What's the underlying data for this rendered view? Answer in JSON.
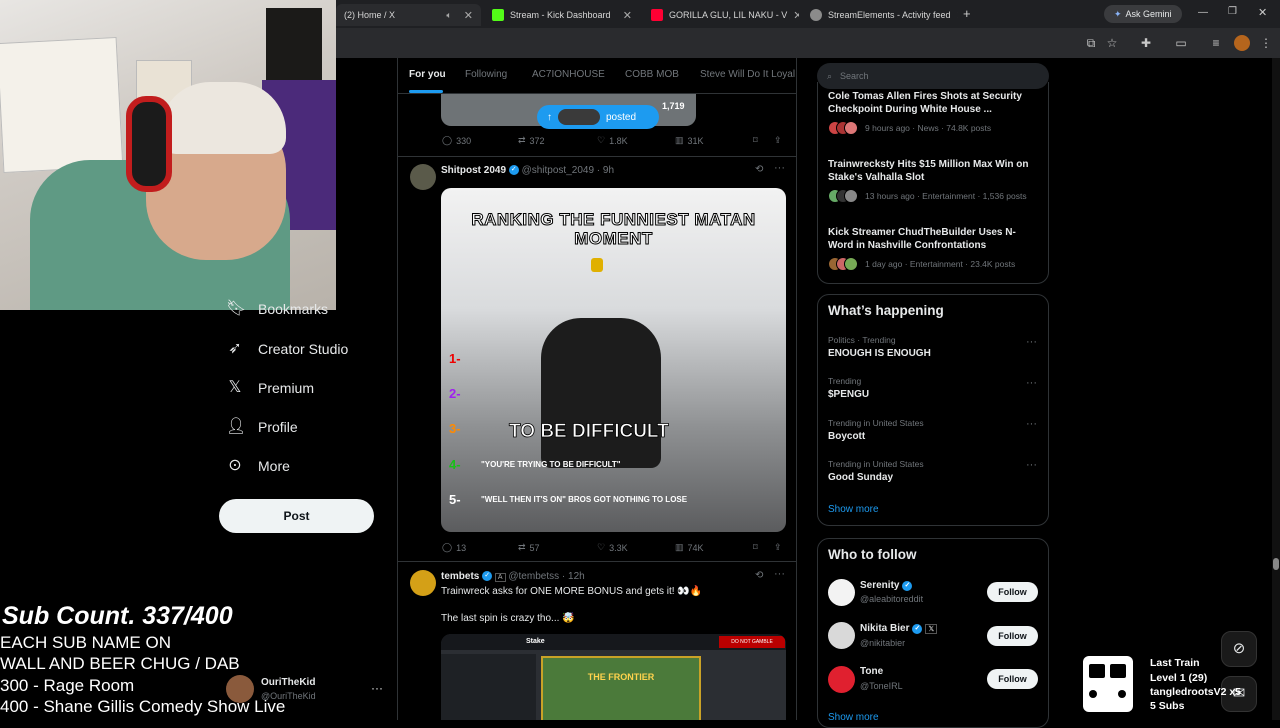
{
  "browser": {
    "tabs": [
      {
        "label": "(2) Home / X",
        "favicon_color": "#000000"
      },
      {
        "label": "Stream - Kick Dashboard",
        "favicon_color": "#53fc18"
      },
      {
        "label": "GORILLA GLU, LIL NAKU - V",
        "favicon_color": "#ff0033"
      },
      {
        "label": "StreamElements - Activity feed",
        "favicon_color": "#8b8b8b"
      }
    ],
    "new_tab": "+",
    "gemini_label": "Ask Gemini"
  },
  "overlay": {
    "sub_count": "Sub Count. 337/400",
    "lines": [
      "EACH SUB NAME ON",
      "WALL AND BEER CHUG / DAB",
      "300 - Rage Room",
      "400 - Shane Gillis Comedy Show Live"
    ]
  },
  "sidebar": {
    "items": [
      {
        "label": "Bookmarks",
        "icon": "bookmark-icon"
      },
      {
        "label": "Creator Studio",
        "icon": "rocket-icon"
      },
      {
        "label": "Premium",
        "icon": "x-logo-icon"
      },
      {
        "label": "Profile",
        "icon": "person-icon"
      },
      {
        "label": "More",
        "icon": "more-circle-icon"
      }
    ],
    "post_button": "Post",
    "account": {
      "name": "OuriTheKid",
      "handle": "@OuriTheKid"
    }
  },
  "feed": {
    "tabs": [
      "For you",
      "Following",
      "AC7IONHOUSE",
      "COBB MOB",
      "Steve Will Do It Loyal"
    ],
    "posted_pill": "posted",
    "top_post": {
      "image_count": "1,719",
      "actions": {
        "replies": "330",
        "reposts": "372",
        "likes": "1.8K",
        "views": "31K"
      }
    },
    "post1": {
      "name": "Shitpost 2049",
      "handle": "@shitpost_2049",
      "time": "9h",
      "media_title": "RANKING THE FUNNIEST MATAN MOMENT",
      "media_caption": "TO BE DIFFICULT",
      "media_line4": "\"YOU'RE TRYING TO BE DIFFICULT\"",
      "media_line5": "\"WELL THEN IT'S ON\" BROS GOT NOTHING TO LOSE",
      "rank_labels": [
        "1-",
        "2-",
        "3-",
        "4-",
        "5-"
      ],
      "actions": {
        "replies": "13",
        "reposts": "57",
        "likes": "3.3K",
        "views": "74K"
      }
    },
    "post2": {
      "name": "tembets",
      "badge": "A",
      "handle": "@tembetss",
      "time": "12h",
      "text": "Trainwreck asks for ONE MORE BONUS and gets it! 👀🔥",
      "text2": "The last spin is crazy tho... 🤯",
      "media_label": "THE FRONTIER",
      "media_tag": "DO NOT GAMBLE",
      "media_logo": "Stake"
    }
  },
  "right": {
    "search_placeholder": "Search",
    "news": [
      {
        "title": "Cole Tomas Allen Fires Shots at Security Checkpoint During White House ...",
        "meta": "9 hours ago · News · 74.8K posts"
      },
      {
        "title": "Trainwrecksty Hits $15 Million Max Win on Stake's Valhalla Slot",
        "meta": "13 hours ago · Entertainment · 1,536 posts"
      },
      {
        "title": "Kick Streamer ChudTheBuilder Uses N-Word in Nashville Confrontations",
        "meta": "1 day ago · Entertainment · 23.4K posts"
      }
    ],
    "happening_title": "What’s happening",
    "trends": [
      {
        "category": "Politics · Trending",
        "name": "ENOUGH IS ENOUGH"
      },
      {
        "category": "Trending",
        "name": "$PENGU"
      },
      {
        "category": "Trending in United States",
        "name": "Boycott"
      },
      {
        "category": "Trending in United States",
        "name": "Good Sunday"
      }
    ],
    "show_more": "Show more",
    "wtf_title": "Who to follow",
    "follow": [
      {
        "name": "Serenity",
        "handle": "@aleabitoreddit",
        "color": "#f3f3f3"
      },
      {
        "name": "Nikita Bier",
        "handle": "@nikitabier",
        "color": "#d9d9d9"
      },
      {
        "name": "Tone",
        "handle": "@ToneIRL",
        "color": "#e0202f"
      }
    ],
    "follow_label": "Follow",
    "show_more_bottom": "Show more"
  },
  "widget": {
    "lines": [
      "Last Train",
      "Level 1  (29)",
      "tangledrootsV2 x5",
      "5 Subs"
    ]
  }
}
